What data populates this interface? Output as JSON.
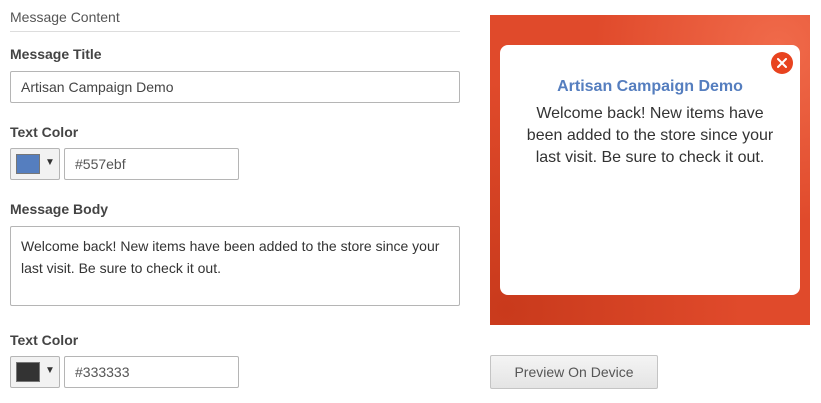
{
  "section": {
    "title": "Message Content"
  },
  "message_title": {
    "label": "Message Title",
    "value": "Artisan Campaign Demo"
  },
  "title_color": {
    "label": "Text Color",
    "swatch": "#557ebf",
    "hex": "#557ebf"
  },
  "message_body": {
    "label": "Message Body",
    "value": "Welcome back! New items have been added to the store since your last visit. Be sure to check it out."
  },
  "body_color": {
    "label": "Text Color",
    "swatch": "#333333",
    "hex": "#333333"
  },
  "preview": {
    "title": "Artisan Campaign Demo",
    "body": "Welcome back! New items have been added to the store since your last visit. Be sure to check it out.",
    "title_color": "#557ebf",
    "body_color": "#333333",
    "close_icon": "close-icon",
    "accent": "#e8431f"
  },
  "actions": {
    "preview_button": "Preview On Device"
  }
}
